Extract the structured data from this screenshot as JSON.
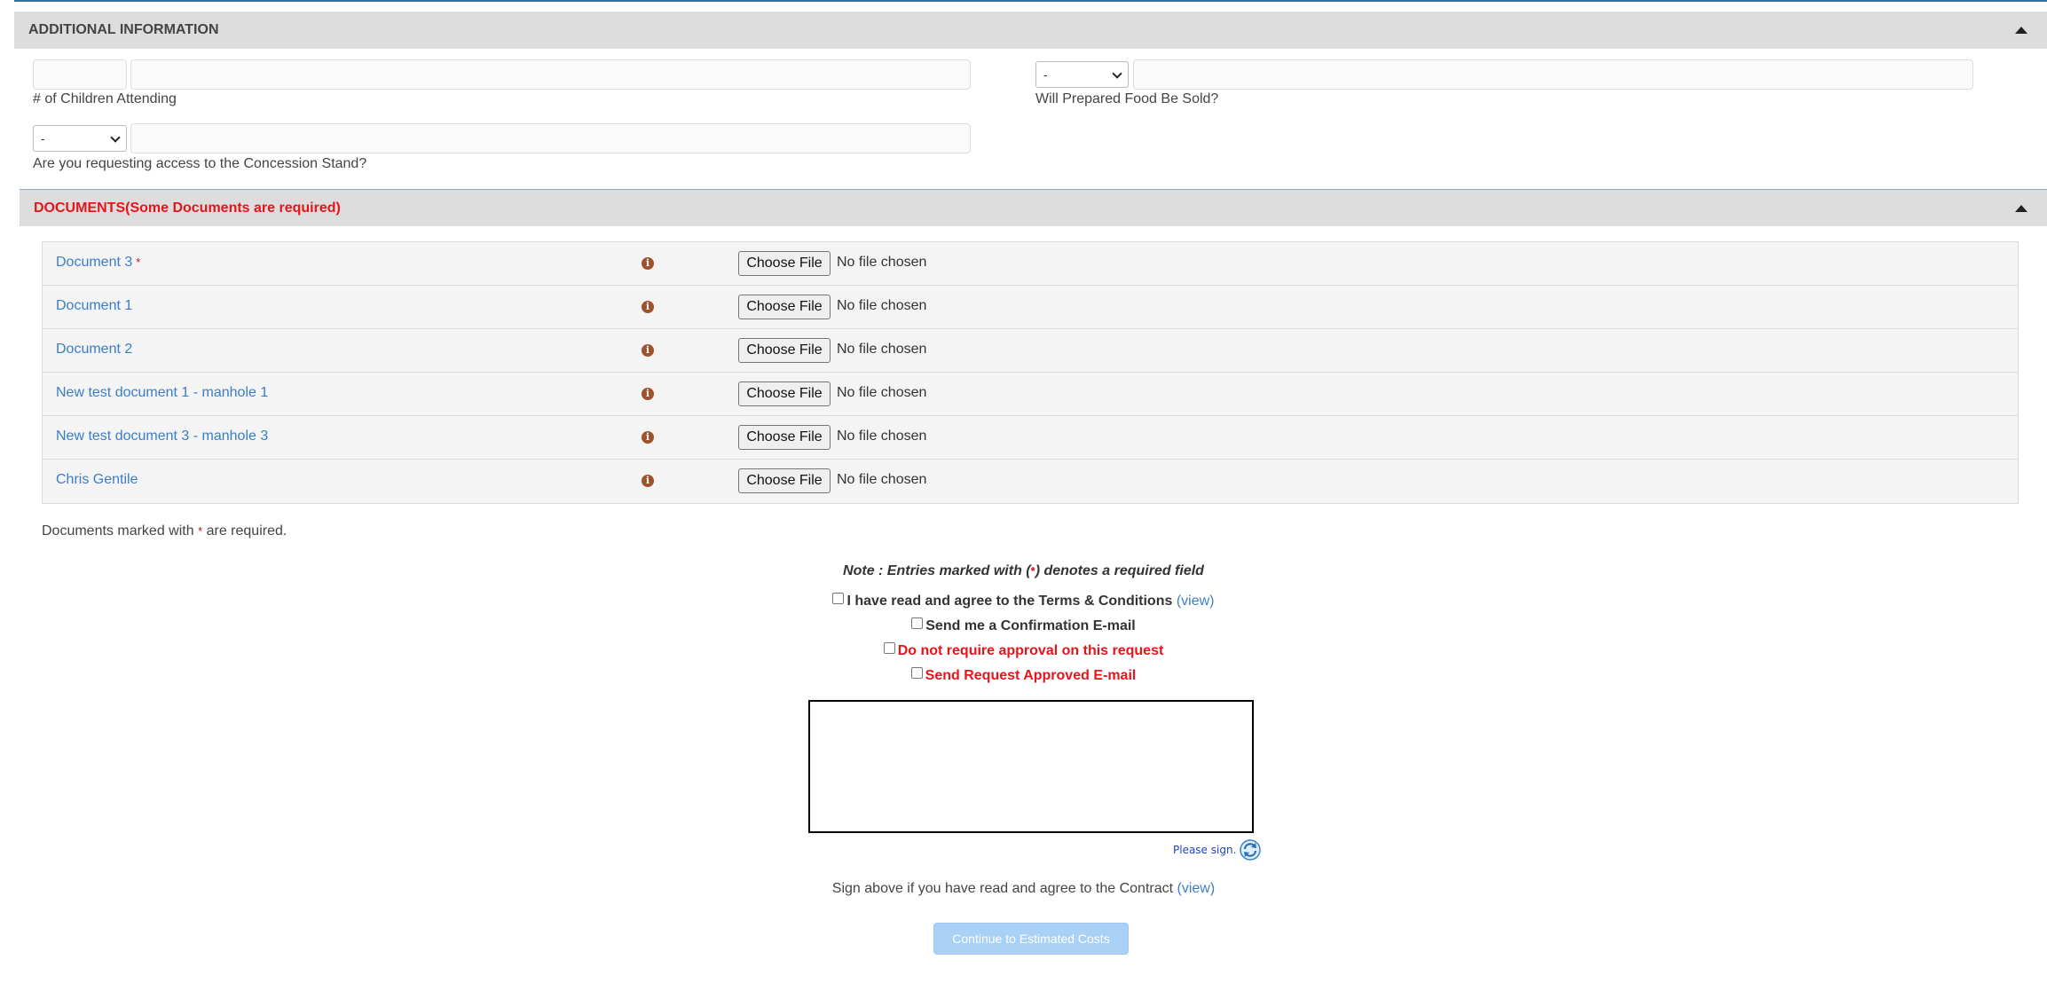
{
  "additional_info": {
    "header": "ADDITIONAL INFORMATION",
    "fields": {
      "children_label": "# of Children Attending",
      "food_select": "-",
      "food_label": "Will Prepared Food Be Sold?",
      "concession_select": "-",
      "concession_label": "Are you requesting access to the Concession Stand?"
    }
  },
  "documents": {
    "header": "DOCUMENTS(Some Documents are required)",
    "rows": [
      {
        "name": "Document 3",
        "required": "*",
        "button": "Choose File",
        "status": "No file chosen"
      },
      {
        "name": "Document 1",
        "button": "Choose File",
        "status": "No file chosen"
      },
      {
        "name": "Document 2",
        "button": "Choose File",
        "status": "No file chosen"
      },
      {
        "name": "New test document 1 - manhole 1",
        "button": "Choose File",
        "status": "No file chosen"
      },
      {
        "name": "New test document 3 - manhole 3",
        "button": "Choose File",
        "status": "No file chosen"
      },
      {
        "name": "Chris Gentile",
        "button": "Choose File",
        "status": "No file chosen"
      }
    ],
    "note_prefix": "Documents marked with",
    "note_star": "*",
    "note_suffix": "are required."
  },
  "footer": {
    "required_note_prefix": "Note : Entries marked with (",
    "required_note_star": "*",
    "required_note_suffix": ") denotes a required field",
    "terms_label": "I have read and agree to the Terms & Conditions",
    "terms_view": "(view)",
    "confirm_email_label": "Send me a Confirmation E-mail",
    "no_approval_label": "Do not require approval on this request",
    "approved_email_label": "Send Request Approved E-mail",
    "please_sign": "Please sign.",
    "sign_above": "Sign above if you have read and agree to the Contract",
    "contract_view": "(view)",
    "continue_label": "Continue to Estimated Costs"
  },
  "colors": {
    "section_header_bg": "#dddddd",
    "required_red": "#e8141c",
    "link_blue": "#3a7ec9",
    "info_icon": "#a0522d",
    "continue_disabled": "#a9d0f5"
  }
}
